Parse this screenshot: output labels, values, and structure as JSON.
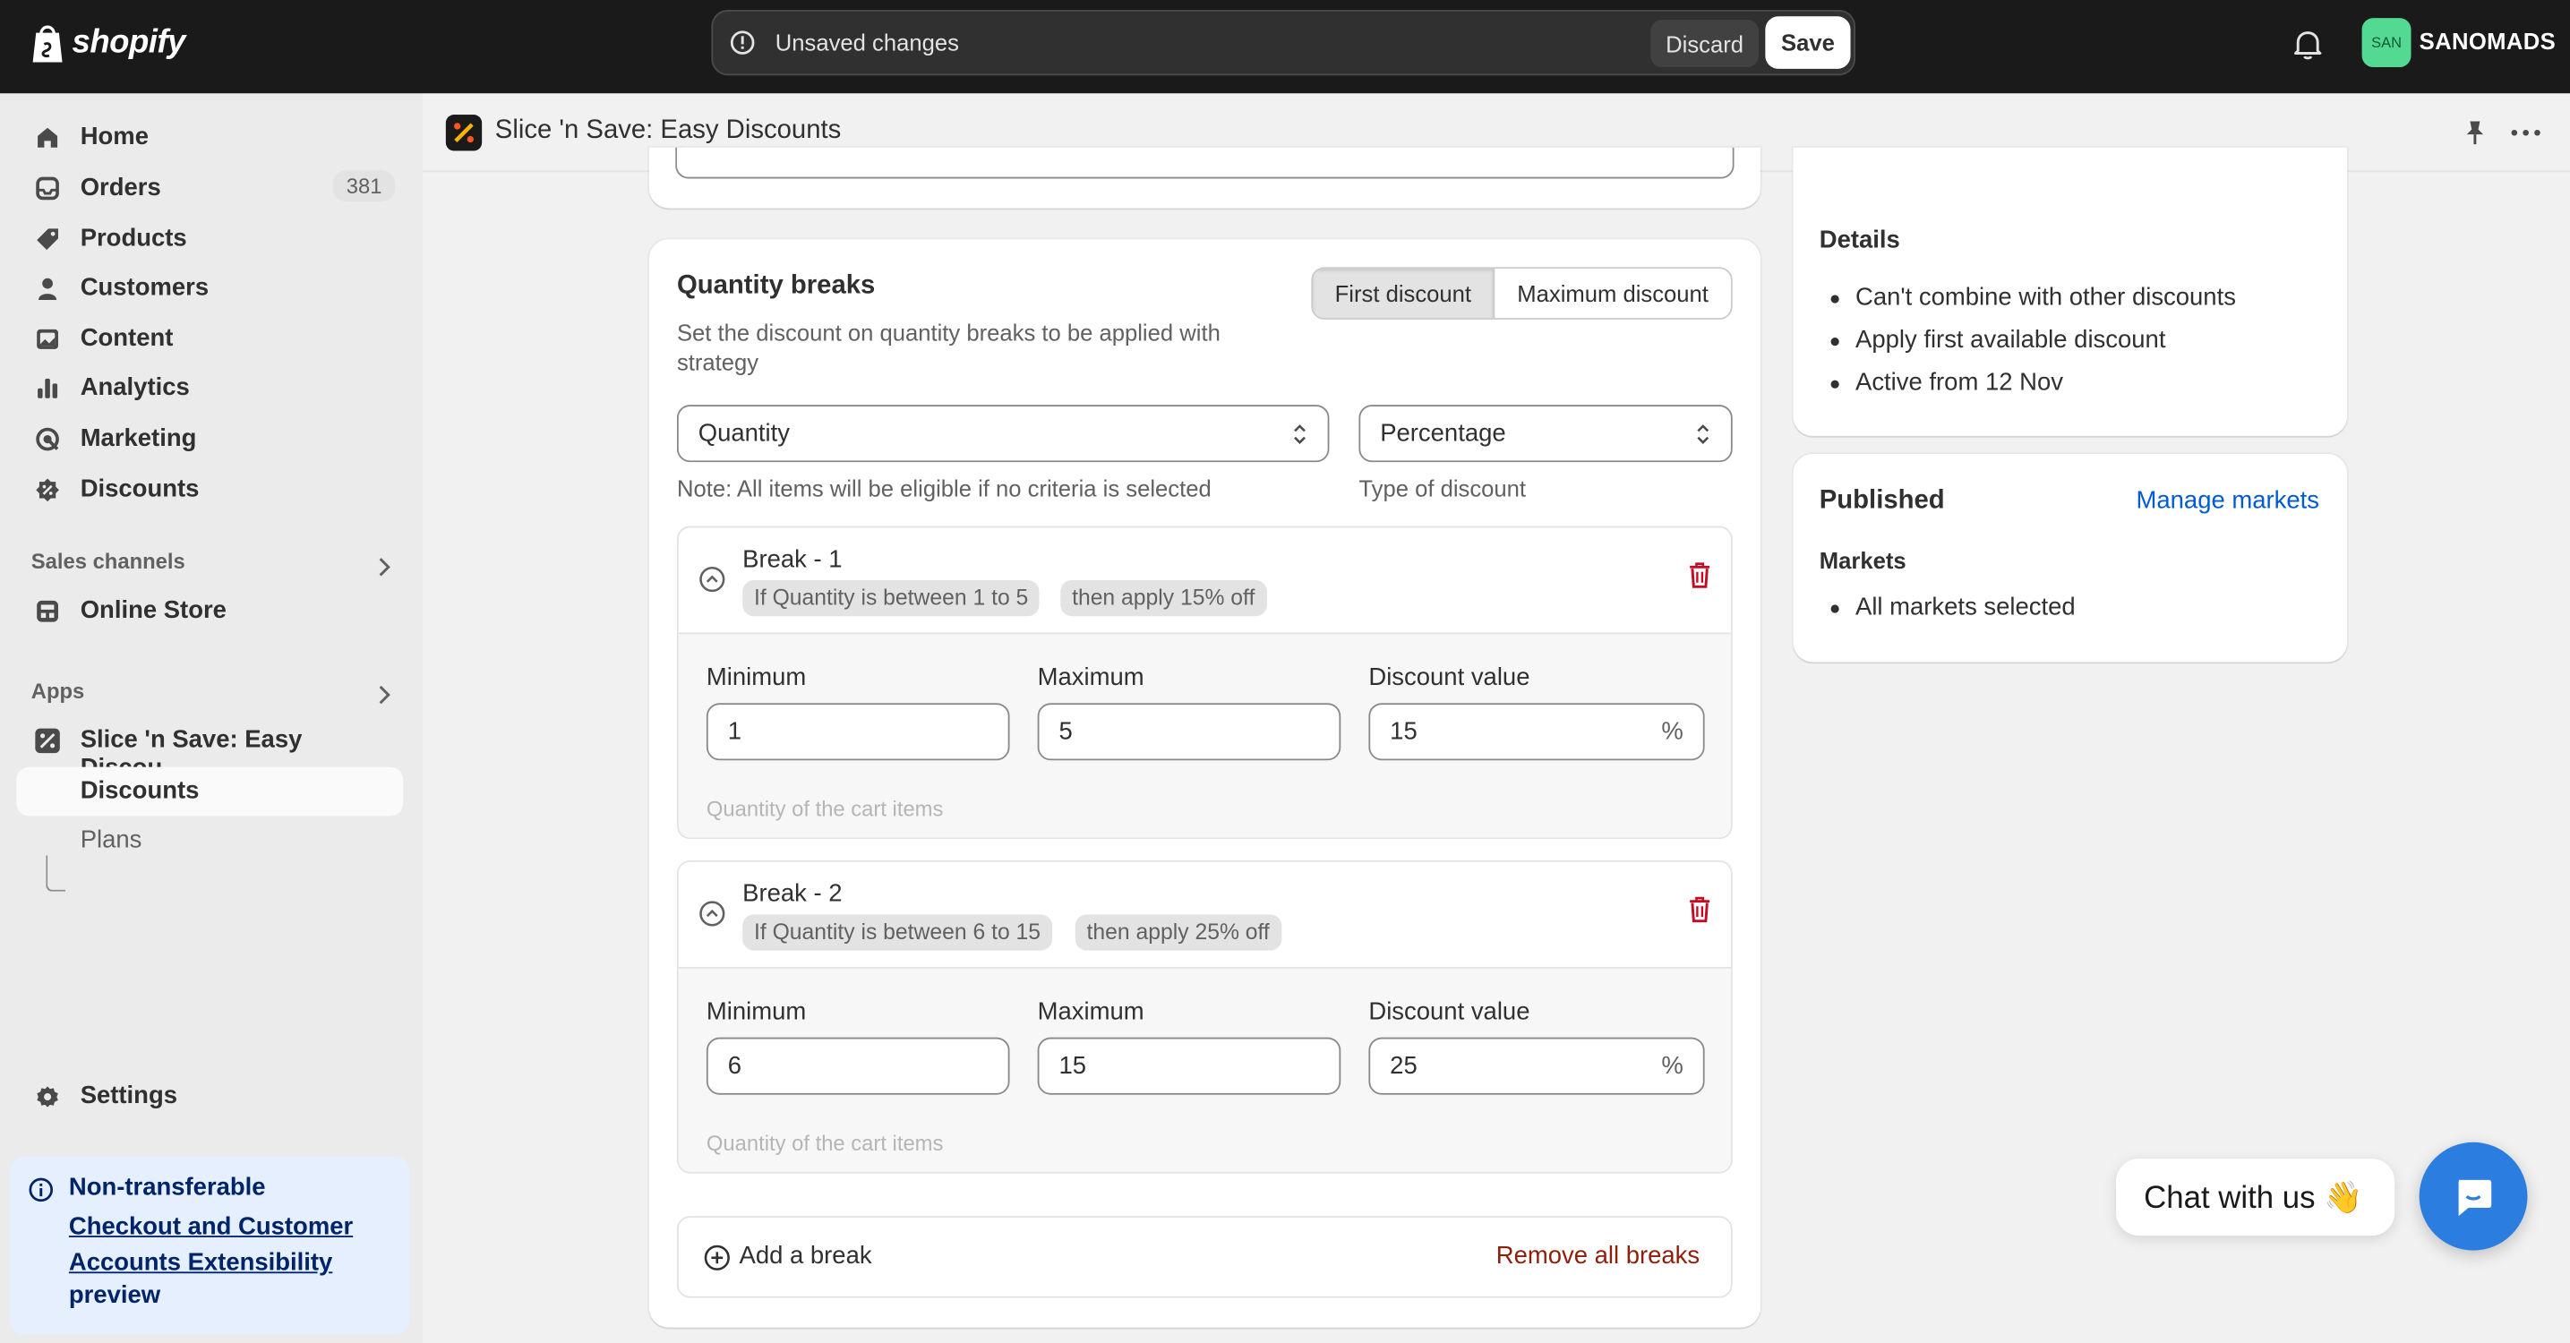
{
  "brand": {
    "name": "shopify"
  },
  "savebar": {
    "message": "Unsaved changes",
    "discard": "Discard",
    "save": "Save"
  },
  "account": {
    "avatar_initials": "SAN",
    "store_name": "SANOMADS",
    "avatar_color": "#54d993"
  },
  "sidebar": {
    "items": [
      {
        "label": "Home",
        "icon": "home-icon"
      },
      {
        "label": "Orders",
        "icon": "orders-icon",
        "badge": "381"
      },
      {
        "label": "Products",
        "icon": "tag-icon"
      },
      {
        "label": "Customers",
        "icon": "person-icon"
      },
      {
        "label": "Content",
        "icon": "image-icon"
      },
      {
        "label": "Analytics",
        "icon": "bar-chart-icon"
      },
      {
        "label": "Marketing",
        "icon": "target-icon"
      },
      {
        "label": "Discounts",
        "icon": "discount-icon"
      }
    ],
    "sales_channels_title": "Sales channels",
    "online_store": "Online Store",
    "apps_title": "Apps",
    "app_item": "Slice 'n Save: Easy Discou...",
    "app_sub_discounts": "Discounts",
    "app_sub_plans": "Plans",
    "settings": "Settings",
    "banner": {
      "line1": "Non-transferable",
      "link": "Checkout and Customer Accounts Extensibility",
      "line3": "preview"
    }
  },
  "app_header": {
    "title": "Slice 'n Save: Easy Discounts"
  },
  "quantity_breaks": {
    "title": "Quantity breaks",
    "description": "Set the discount on quantity breaks to be applied with strategy",
    "strategy": {
      "first": "First discount",
      "maximum": "Maximum discount",
      "selected": "First discount"
    },
    "criteria_select": "Quantity",
    "criteria_help": "Note: All items will be eligible if no criteria is selected",
    "type_select": "Percentage",
    "type_help": "Type of discount",
    "field_labels": {
      "minimum": "Minimum",
      "maximum": "Maximum",
      "discount_value": "Discount value",
      "suffix": "%"
    },
    "field_help": "Quantity of the cart items",
    "breaks": [
      {
        "title": "Break - 1",
        "condition": "If Quantity is between 1 to 5",
        "action": "then apply 15% off",
        "minimum": "1",
        "maximum": "5",
        "discount": "15"
      },
      {
        "title": "Break - 2",
        "condition": "If Quantity is between 6 to 15",
        "action": "then apply 25% off",
        "minimum": "6",
        "maximum": "15",
        "discount": "25"
      }
    ],
    "add_break": "Add a break",
    "remove_all": "Remove all breaks"
  },
  "details": {
    "title": "Details",
    "items": [
      "Can't combine with other discounts",
      "Apply first available discount",
      "Active from 12 Nov"
    ]
  },
  "published": {
    "title": "Published",
    "manage_link": "Manage markets",
    "markets_title": "Markets",
    "markets_items": [
      "All markets selected"
    ]
  },
  "chat": {
    "label": "Chat with us 👋"
  },
  "colors": {
    "topbar": "#1a1a1a",
    "link": "#005bd3",
    "critical": "#8e1f0b",
    "chat_button": "#2b7de0"
  }
}
